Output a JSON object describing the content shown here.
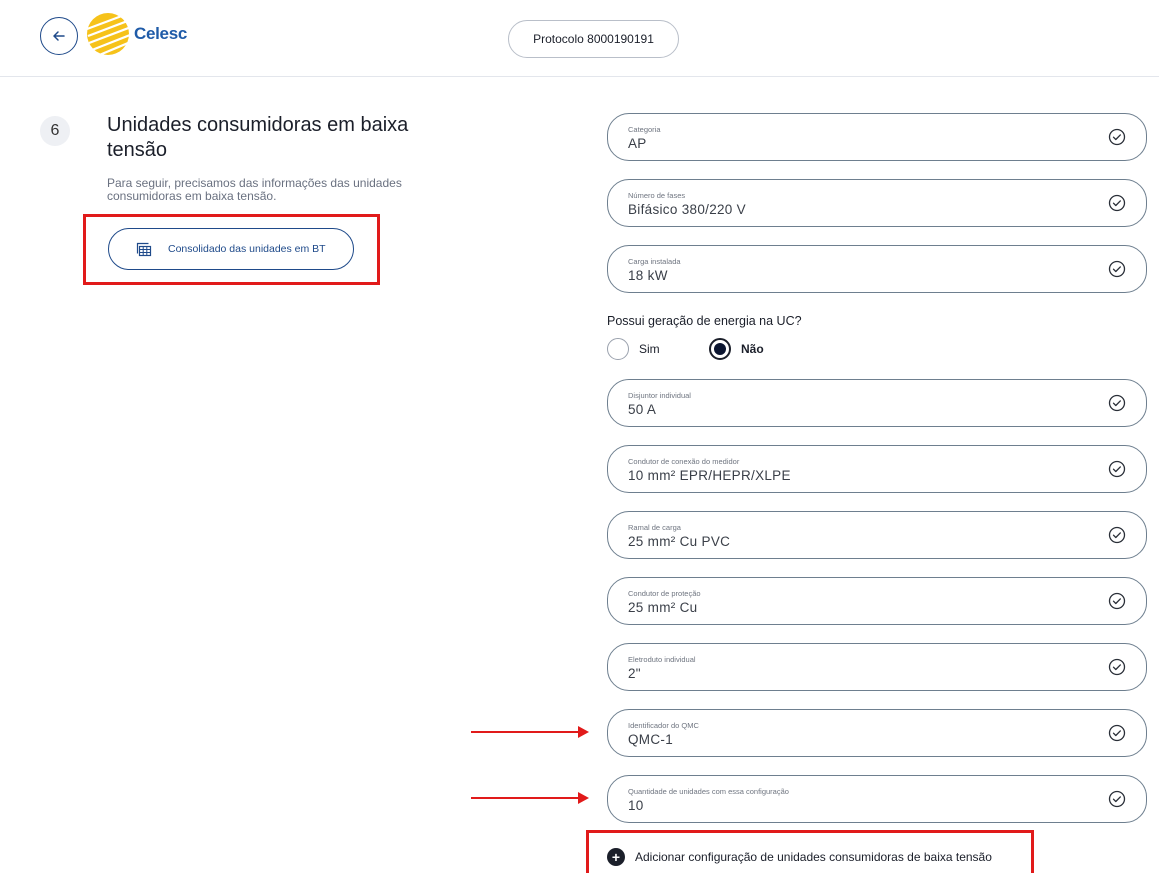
{
  "header": {
    "logo_text": "Celesc",
    "protocol": "Protocolo 8000190191"
  },
  "section": {
    "step": "6",
    "title": "Unidades consumidoras em baixa tensão",
    "description": "Para seguir, precisamos das informações das unidades consumidoras em baixa tensão.",
    "consolidado_label": "Consolidado das unidades em BT"
  },
  "fields": [
    {
      "label": "Categoria",
      "value": "AP"
    },
    {
      "label": "Número de fases",
      "value": "Bifásico 380/220 V"
    },
    {
      "label": "Carga instalada",
      "value": "18 kW"
    },
    {
      "label": "Disjuntor individual",
      "value": "50 A"
    },
    {
      "label": "Condutor de conexão do medidor",
      "value": "10 mm² EPR/HEPR/XLPE"
    },
    {
      "label": "Ramal de carga",
      "value": "25 mm² Cu PVC"
    },
    {
      "label": "Condutor de proteção",
      "value": "25 mm² Cu"
    },
    {
      "label": "Eletroduto individual",
      "value": "2\""
    },
    {
      "label": "Identificador do QMC",
      "value": "QMC-1"
    },
    {
      "label": "Quantidade de unidades com essa configuração",
      "value": "10"
    }
  ],
  "generation": {
    "question": "Possui geração de energia na UC?",
    "options": [
      "Sim",
      "Não"
    ],
    "selected": "Não"
  },
  "add_button_label": "Adicionar configuração de unidades consumidoras de baixa tensão",
  "colors": {
    "accent": "#1f4a8a",
    "annotation": "#e11a1a",
    "check": "#2a2f38"
  }
}
